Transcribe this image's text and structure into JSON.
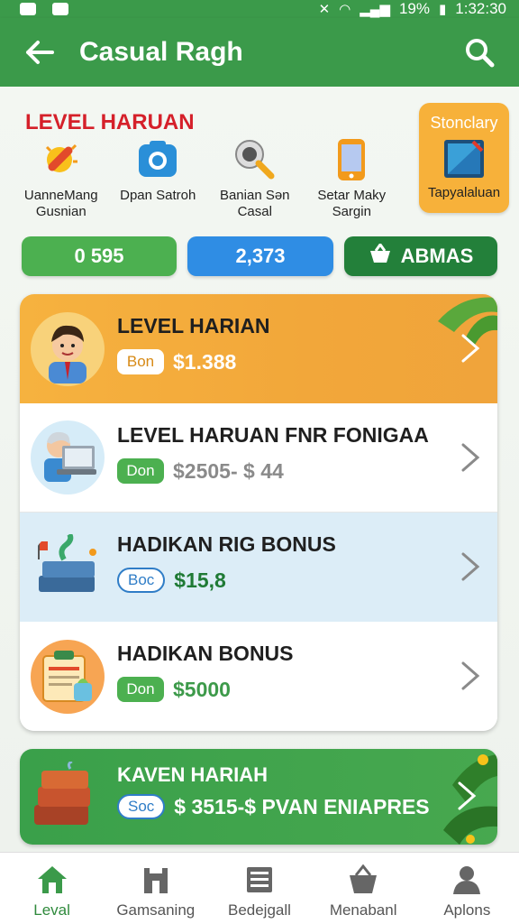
{
  "status_bar": {
    "time": "1:32:30",
    "battery": "19%"
  },
  "app_bar": {
    "title": "Casual Ragh"
  },
  "categories": {
    "section_title": "LEVEL HARUAN",
    "items": [
      {
        "label_1": "UanneMang",
        "label_2": "Gusnian",
        "icon": "candy-icon"
      },
      {
        "label_1": "Dpan Satroh",
        "label_2": "",
        "icon": "camera-icon"
      },
      {
        "label_1": "Banian Sən",
        "label_2": "Casal",
        "icon": "microphone-icon"
      },
      {
        "label_1": "Setar Maky",
        "label_2": "Sargin",
        "icon": "phone-icon"
      }
    ],
    "special": {
      "top": "Stonclary",
      "label": "Tapyalaluan",
      "icon": "tablet-icon"
    }
  },
  "pills": {
    "first": "0 595",
    "second": "2,373",
    "third": "ABMAS"
  },
  "list": [
    {
      "title": "LEVEL HARIAN",
      "badge": "Bon",
      "amount": "$1.388"
    },
    {
      "title": "LEVEL HARUAN FNR FONIGAA",
      "badge": "Don",
      "amount": "$2505- $ 44"
    },
    {
      "title": "HADIKAN RIG BONUS",
      "badge": "Boc",
      "amount": "$15,8"
    },
    {
      "title": "HADIKAN BONUS",
      "badge": "Don",
      "amount": "$5000"
    }
  ],
  "banner": {
    "title": "KAVEN HARIAH",
    "badge": "Soc",
    "amount": "$ 3515-$ PVAN ENIAPRES"
  },
  "bottom_nav": [
    {
      "label": "Leval",
      "icon": "home-icon",
      "active": true
    },
    {
      "label": "Gamsaning",
      "icon": "castle-icon",
      "active": false
    },
    {
      "label": "Bedejgall",
      "icon": "document-icon",
      "active": false
    },
    {
      "label": "Menabanl",
      "icon": "basket-icon",
      "active": false
    },
    {
      "label": "Aplons",
      "icon": "person-icon",
      "active": false
    }
  ],
  "colors": {
    "primary_green": "#3b9a4a",
    "accent_orange": "#f6b23f",
    "accent_blue": "#2f8de4",
    "title_red": "#d5202a",
    "amount_white": "#ffffff",
    "amount_gray": "#8a8a8a",
    "amount_green": "#1f7a35"
  }
}
